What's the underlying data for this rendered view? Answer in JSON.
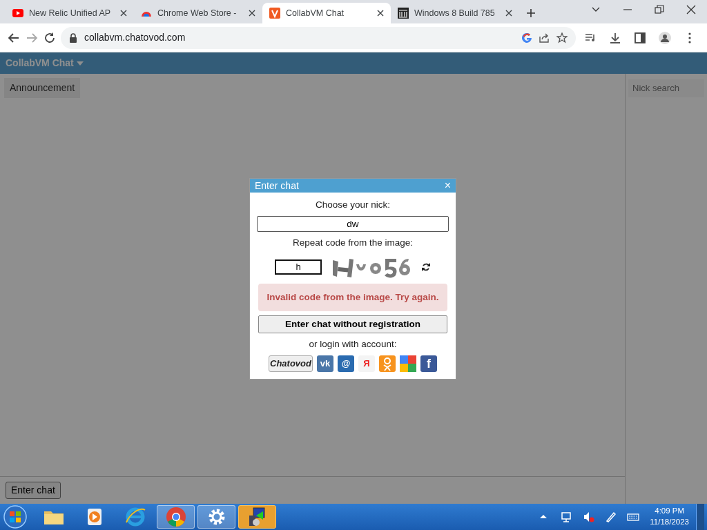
{
  "browser": {
    "tabs": [
      {
        "title": "New Relic Unified AP",
        "kind": "video",
        "selected": false
      },
      {
        "title": "Chrome Web Store -",
        "kind": "store",
        "selected": false
      },
      {
        "title": "CollabVM Chat",
        "kind": "chatovod",
        "selected": true
      },
      {
        "title": "Windows 8 Build 785",
        "kind": "museum",
        "selected": false
      }
    ],
    "url": "collabvm.chatovod.com"
  },
  "page": {
    "brand": "CollabVM Chat",
    "announcement": "Announcement",
    "nick_search": {
      "placeholder": "Nick search"
    },
    "enter_chat_button": "Enter chat"
  },
  "dialog": {
    "title": "Enter chat",
    "close": "×",
    "nick_label": "Choose your nick:",
    "nick_value": "dw",
    "code_label": "Repeat code from the image:",
    "code_value": "h",
    "error": "Invalid code from the image. Try again.",
    "submit": "Enter chat without registration",
    "login_label": "or login with account:",
    "providers": [
      {
        "kind": "chatovod",
        "text": "Chatovod"
      },
      {
        "kind": "vk",
        "text": "vk"
      },
      {
        "kind": "mail",
        "text": "@"
      },
      {
        "kind": "yandex",
        "text": "Я"
      },
      {
        "kind": "ok"
      },
      {
        "kind": "google"
      },
      {
        "kind": "facebook",
        "text": "f"
      }
    ]
  },
  "taskbar": {
    "apps": [
      {
        "kind": "folder",
        "open": false,
        "flashing": false
      },
      {
        "kind": "media",
        "open": false,
        "flashing": false
      },
      {
        "kind": "ie",
        "open": false,
        "flashing": false
      },
      {
        "kind": "chrome",
        "open": true,
        "flashing": false
      },
      {
        "kind": "settings",
        "open": true,
        "flashing": false
      },
      {
        "kind": "vm",
        "open": true,
        "flashing": true
      }
    ],
    "time": "4:09 PM",
    "date": "11/18/2023"
  }
}
